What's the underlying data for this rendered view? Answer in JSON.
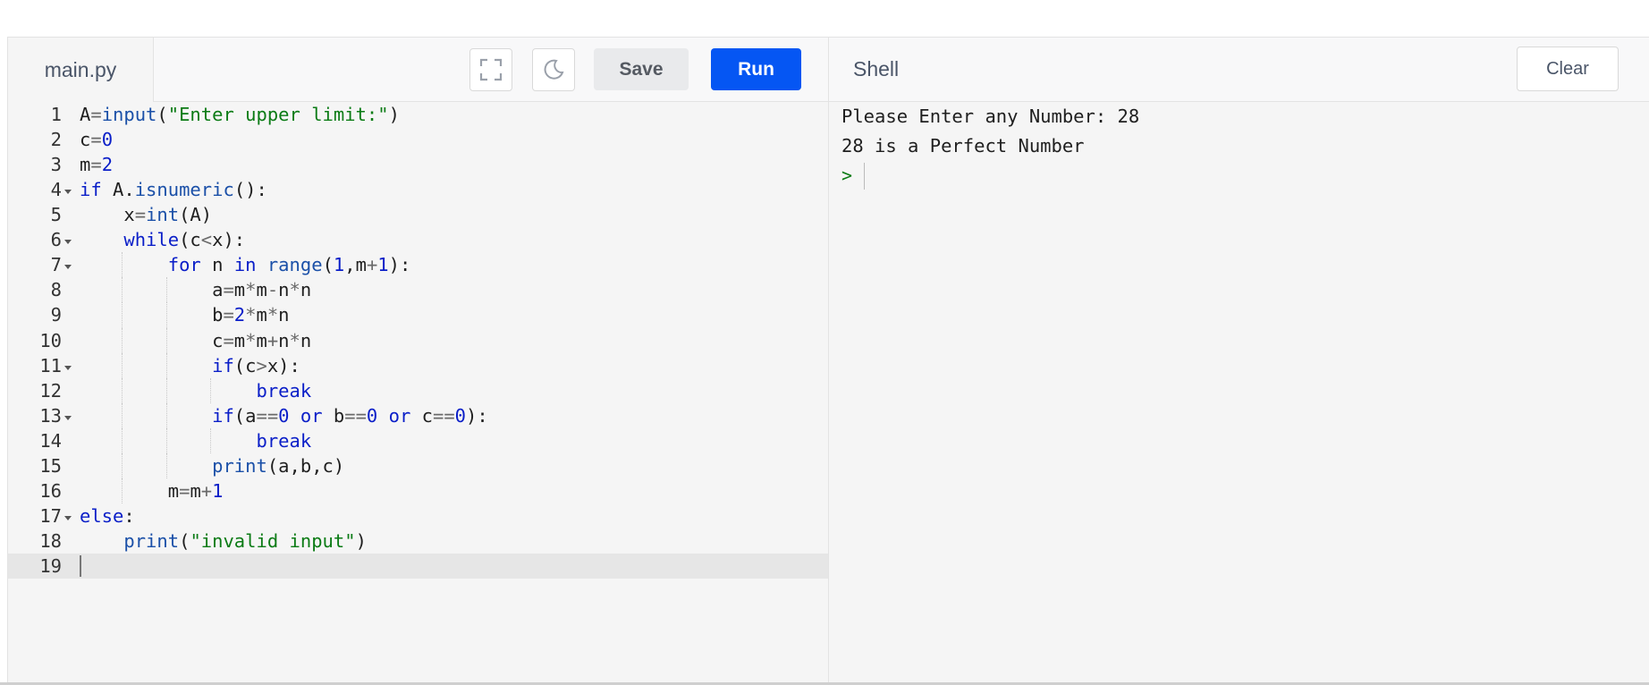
{
  "editor": {
    "file_tab": "main.py",
    "save_label": "Save",
    "run_label": "Run",
    "fullscreen_icon": "fullscreen-icon",
    "theme_icon": "moon-icon",
    "current_line": 19,
    "lines": [
      {
        "num": "1",
        "code": "A=input(\"Enter upper limit:\")"
      },
      {
        "num": "2",
        "code": "c=0"
      },
      {
        "num": "3",
        "code": "m=2"
      },
      {
        "num": "4",
        "code": "if A.isnumeric():"
      },
      {
        "num": "5",
        "code": "    x=int(A)"
      },
      {
        "num": "6",
        "code": "    while(c<x):"
      },
      {
        "num": "7",
        "code": "        for n in range(1,m+1):"
      },
      {
        "num": "8",
        "code": "            a=m*m-n*n"
      },
      {
        "num": "9",
        "code": "            b=2*m*n"
      },
      {
        "num": "10",
        "code": "            c=m*m+n*n"
      },
      {
        "num": "11",
        "code": "            if(c>x):"
      },
      {
        "num": "12",
        "code": "                break"
      },
      {
        "num": "13",
        "code": "            if(a==0 or b==0 or c==0):"
      },
      {
        "num": "14",
        "code": "                break"
      },
      {
        "num": "15",
        "code": "            print(a,b,c)"
      },
      {
        "num": "16",
        "code": "        m=m+1"
      },
      {
        "num": "17",
        "code": "else:"
      },
      {
        "num": "18",
        "code": "    print(\"invalid input\")"
      },
      {
        "num": "19",
        "code": ""
      }
    ]
  },
  "shell": {
    "title": "Shell",
    "clear_label": "Clear",
    "output": [
      "Please Enter any Number: 28",
      "28 is a Perfect Number"
    ],
    "prompt": ">"
  },
  "colors": {
    "run_button": "#0556f3",
    "keyword": "#0a1ec8",
    "string": "#0b7b15",
    "background": "#f5f5f5"
  }
}
